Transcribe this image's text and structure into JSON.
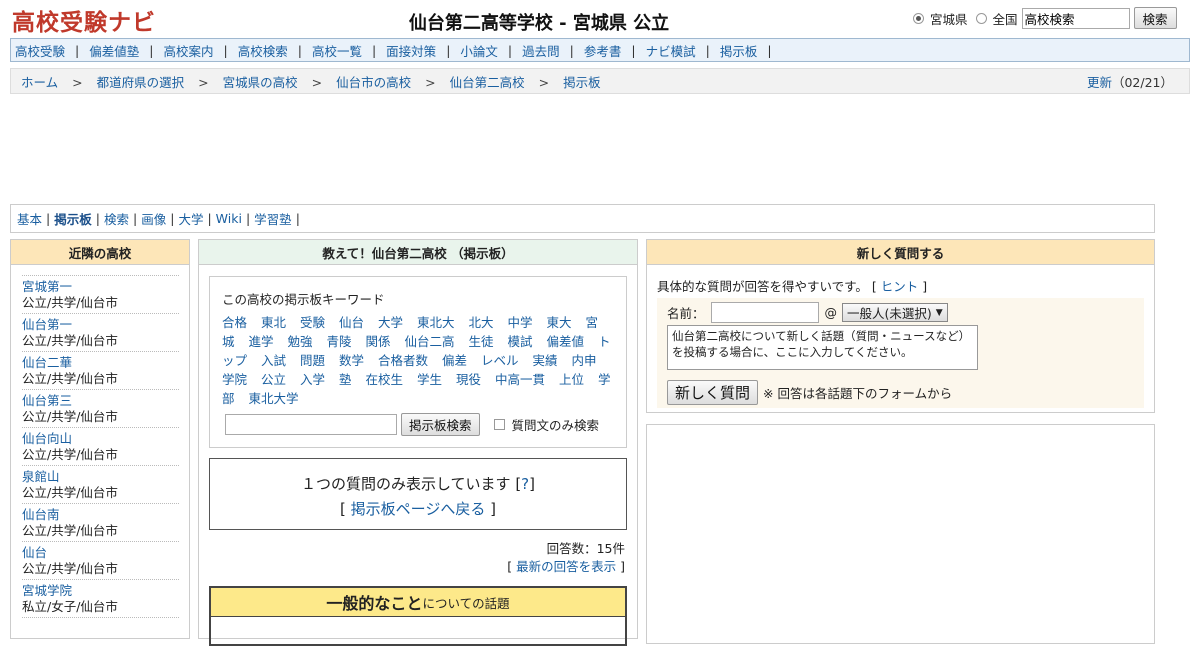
{
  "header": {
    "logo": "高校受験ナビ",
    "title": "仙台第二高等学校 - 宮城県 公立",
    "search": {
      "radio_pref": "宮城県",
      "radio_all": "全国",
      "input_value": "高校検索",
      "button": "検索"
    }
  },
  "nav": [
    "高校受験",
    "偏差値塾",
    "高校案内",
    "高校検索",
    "高校一覧",
    "面接対策",
    "小論文",
    "過去問",
    "参考書",
    "ナビ模試",
    "掲示板"
  ],
  "breadcrumb": {
    "items": [
      "ホーム",
      "都道府県の選択",
      "宮城県の高校",
      "仙台市の高校",
      "仙台第二高校",
      "掲示板"
    ],
    "update_link": "更新",
    "update_date": "（02/21）"
  },
  "subnav": [
    "基本",
    "掲示板",
    "検索",
    "画像",
    "大学",
    "Wiki",
    "学習塾"
  ],
  "left": {
    "title": "近隣の高校",
    "schools": [
      {
        "name": "宮城第一",
        "info": "公立/共学/仙台市"
      },
      {
        "name": "仙台第一",
        "info": "公立/共学/仙台市"
      },
      {
        "name": "仙台二華",
        "info": "公立/共学/仙台市"
      },
      {
        "name": "仙台第三",
        "info": "公立/共学/仙台市"
      },
      {
        "name": "仙台向山",
        "info": "公立/共学/仙台市"
      },
      {
        "name": "泉館山",
        "info": "公立/共学/仙台市"
      },
      {
        "name": "仙台南",
        "info": "公立/共学/仙台市"
      },
      {
        "name": "仙台",
        "info": "公立/共学/仙台市"
      },
      {
        "name": "宮城学院",
        "info": "私立/女子/仙台市"
      }
    ]
  },
  "middle": {
    "title": "教えて！仙台第二高校 （掲示板）",
    "kw_title": "この高校の掲示板キーワード",
    "keywords": [
      "合格",
      "東北",
      "受験",
      "仙台",
      "大学",
      "東北大",
      "北大",
      "中学",
      "東大",
      "宮城",
      "進学",
      "勉強",
      "青陵",
      "関係",
      "仙台二高",
      "生徒",
      "模試",
      "偏差値",
      "トップ",
      "入試",
      "問題",
      "数学",
      "合格者数",
      "偏差",
      "レベル",
      "実績",
      "内申",
      "学院",
      "公立",
      "入学",
      "塾",
      "在校生",
      "学生",
      "現役",
      "中高一貫",
      "上位",
      "学部",
      "東北大学"
    ],
    "search_button": "掲示板検索",
    "only_q": "質問文のみ検索",
    "one_msg": "１つの質問のみ表示しています [",
    "q_mark": "?",
    "one_msg_end": "]",
    "back_open": "[ ",
    "back_link": "掲示板ページへ戻る",
    "back_close": " ]",
    "answers": "回答数：15件",
    "latest_open": "[ ",
    "latest": "最新の回答を表示",
    "latest_close": " ]",
    "topic_big": "一般的なこと",
    "topic_small": "についての話題"
  },
  "right": {
    "title": "新しく質問する",
    "hint_text": "具体的な質問が回答を得やすいです。 [ ",
    "hint_link": "ヒント",
    "hint_close": " ]",
    "name_label": "名前：",
    "at": "@",
    "select": "一般人(未選択)",
    "textarea": "仙台第二高校について新しく話題（質問・ニュースなど）を投稿する場合に、ここに入力してください。",
    "ask_button": "新しく質問",
    "note": "※ 回答は各話題下のフォームから"
  }
}
